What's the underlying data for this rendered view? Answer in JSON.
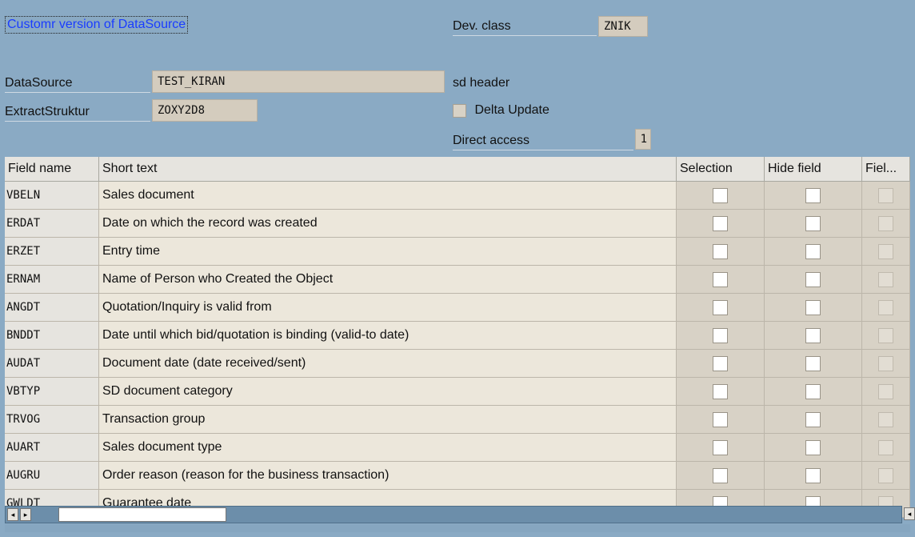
{
  "header": {
    "link_label": "Customr version of DataSource",
    "dev_class_label": "Dev. class",
    "dev_class_value": "ZNIK",
    "datasource_label": "DataSource",
    "datasource_value": "TEST_KIRAN",
    "datasource_desc": "sd header",
    "extract_label": "ExtractStruktur",
    "extract_value": "ZOXY2D8",
    "delta_update_label": "Delta Update",
    "direct_access_label": "Direct access",
    "direct_access_value": "1"
  },
  "table": {
    "columns": [
      "Field name",
      "Short text",
      "Selection",
      "Hide field",
      "Fiel..."
    ],
    "rows": [
      {
        "field": "VBELN",
        "text": "Sales document"
      },
      {
        "field": "ERDAT",
        "text": "Date on which the record was created"
      },
      {
        "field": "ERZET",
        "text": "Entry time"
      },
      {
        "field": "ERNAM",
        "text": "Name of Person who Created the Object"
      },
      {
        "field": "ANGDT",
        "text": "Quotation/Inquiry is valid from"
      },
      {
        "field": "BNDDT",
        "text": "Date until which bid/quotation is binding (valid-to date)"
      },
      {
        "field": "AUDAT",
        "text": "Document date (date received/sent)"
      },
      {
        "field": "VBTYP",
        "text": "SD document category"
      },
      {
        "field": "TRVOG",
        "text": "Transaction group"
      },
      {
        "field": "AUART",
        "text": "Sales document type"
      },
      {
        "field": "AUGRU",
        "text": "Order reason (reason for the business transaction)"
      },
      {
        "field": "GWLDT",
        "text": "Guarantee date"
      }
    ]
  },
  "scrollbar": {
    "left_arrow": "◂",
    "right_arrow": "▸",
    "far_right_arrow": "◂"
  }
}
